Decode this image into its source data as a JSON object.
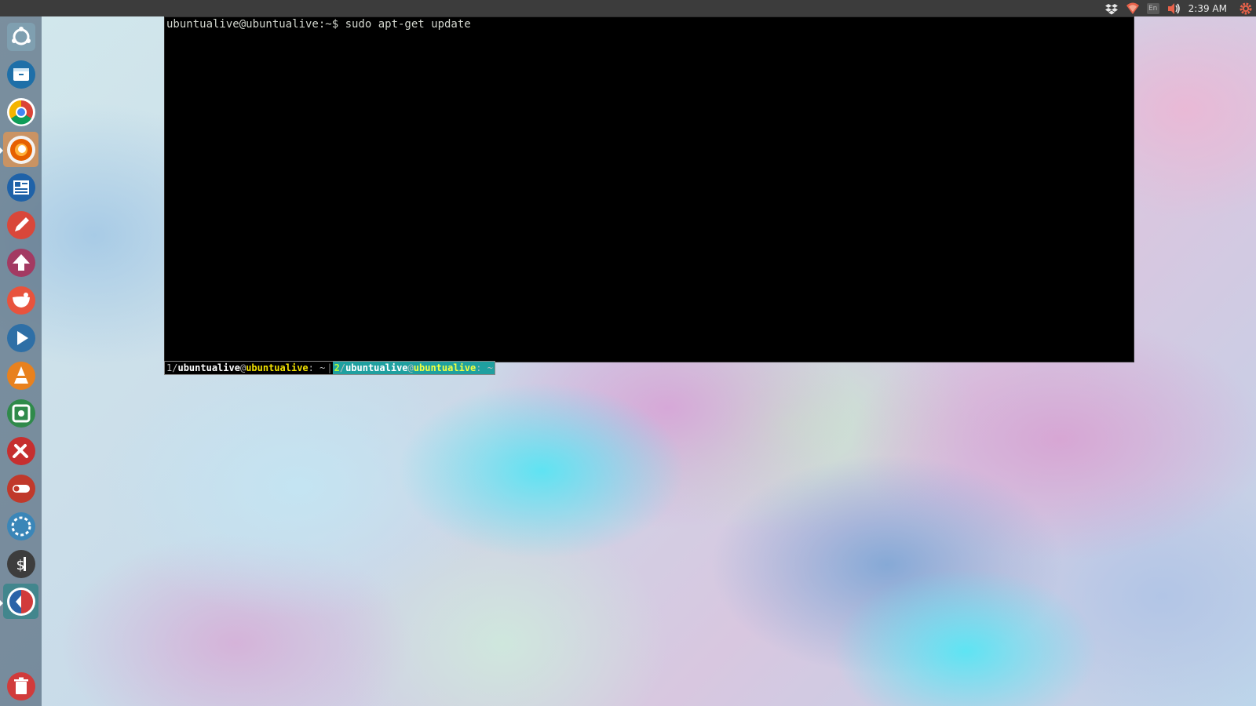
{
  "top_panel": {
    "tray_icons": [
      "dropbox-icon",
      "wifi-icon",
      "keyboard-layout-indicator",
      "volume-icon",
      "session-gear-icon"
    ],
    "keyboard_layout": "En",
    "clock": "2:39 AM",
    "colors": {
      "background": "#3c3c3c",
      "wifi": "#e8624a",
      "gear": "#e8624a"
    }
  },
  "launcher": {
    "items": [
      "dash-home-icon",
      "files-icon",
      "chrome-icon",
      "firefox-icon",
      "writer-icon",
      "text-editor-icon",
      "inkscape-icon",
      "gimp-icon",
      "media-player-icon",
      "vlc-icon",
      "screenshot-icon",
      "system-tools-icon",
      "toggle-app-icon",
      "disks-icon",
      "terminal-icon",
      "software-updater-icon",
      "trash-icon"
    ]
  },
  "terminal": {
    "command_line": "ubuntualive@ubuntualive:~$ sudo apt-get update",
    "tmux": {
      "win1_num": "1",
      "win1_user": "ubuntualive",
      "win1_at": "@",
      "win1_host": "ubuntualive",
      "win1_path": ": ~",
      "divider": "|",
      "win2_num": "2",
      "win2_user": "ubuntualive",
      "win2_at": "@",
      "win2_host": "ubuntualive",
      "win2_path": ": ~"
    }
  }
}
